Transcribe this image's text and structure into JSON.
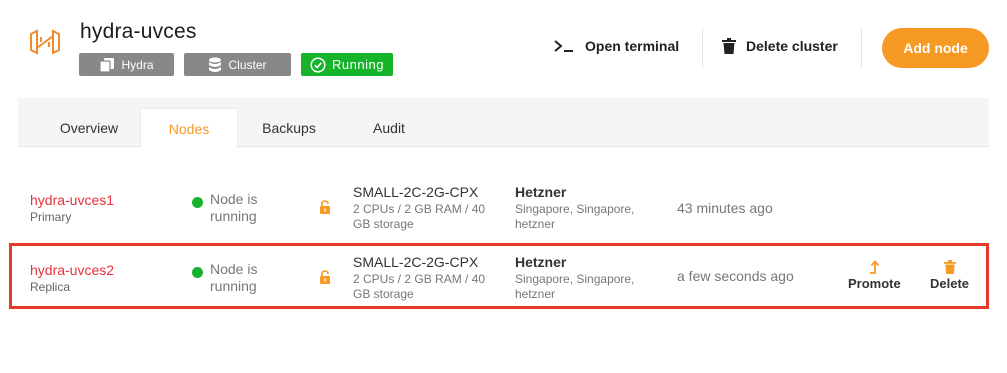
{
  "cluster": {
    "name": "hydra-uvces",
    "badges": {
      "engine": "Hydra",
      "type": "Cluster",
      "status": "Running"
    }
  },
  "header_actions": {
    "open_terminal": "Open terminal",
    "delete_cluster": "Delete cluster",
    "add_node": "Add node"
  },
  "tabs": [
    {
      "label": "Overview"
    },
    {
      "label": "Nodes",
      "active": true
    },
    {
      "label": "Backups"
    },
    {
      "label": "Audit"
    }
  ],
  "nodes": [
    {
      "name": "hydra-uvces1",
      "role": "Primary",
      "status": "Node is running",
      "plan": "SMALL-2C-2G-CPX",
      "spec": "2 CPUs / 2 GB RAM / 40 GB storage",
      "provider": "Hetzner",
      "location": "Singapore, Singapore, hetzner",
      "created": "43 minutes ago"
    },
    {
      "name": "hydra-uvces2",
      "role": "Replica",
      "status": "Node is running",
      "plan": "SMALL-2C-2G-CPX",
      "spec": "2 CPUs / 2 GB RAM / 40 GB storage",
      "provider": "Hetzner",
      "location": "Singapore, Singapore, hetzner",
      "created": "a few seconds ago",
      "actions": {
        "promote": "Promote",
        "delete": "Delete"
      }
    }
  ],
  "colors": {
    "accent": "#f69a23",
    "running": "#16b42b",
    "node_name": "#e5323c",
    "highlight": "#e23b2a"
  },
  "icons": [
    "hydra-logo-icon",
    "copy-icon",
    "database-icon",
    "check-circle-icon",
    "terminal-icon",
    "trash-icon",
    "unlock-icon",
    "promote-icon"
  ]
}
